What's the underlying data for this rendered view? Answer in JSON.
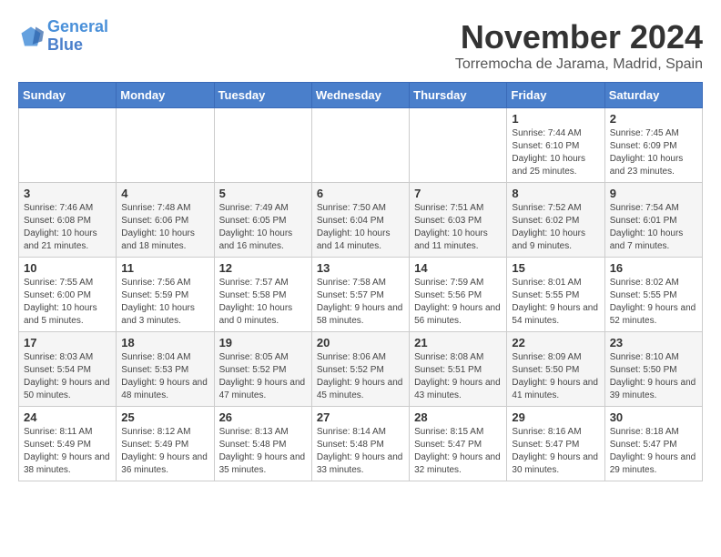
{
  "logo": {
    "line1": "General",
    "line2": "Blue"
  },
  "title": "November 2024",
  "subtitle": "Torremocha de Jarama, Madrid, Spain",
  "weekdays": [
    "Sunday",
    "Monday",
    "Tuesday",
    "Wednesday",
    "Thursday",
    "Friday",
    "Saturday"
  ],
  "weeks": [
    [
      {
        "day": "",
        "info": ""
      },
      {
        "day": "",
        "info": ""
      },
      {
        "day": "",
        "info": ""
      },
      {
        "day": "",
        "info": ""
      },
      {
        "day": "",
        "info": ""
      },
      {
        "day": "1",
        "info": "Sunrise: 7:44 AM\nSunset: 6:10 PM\nDaylight: 10 hours\nand 25 minutes."
      },
      {
        "day": "2",
        "info": "Sunrise: 7:45 AM\nSunset: 6:09 PM\nDaylight: 10 hours\nand 23 minutes."
      }
    ],
    [
      {
        "day": "3",
        "info": "Sunrise: 7:46 AM\nSunset: 6:08 PM\nDaylight: 10 hours\nand 21 minutes."
      },
      {
        "day": "4",
        "info": "Sunrise: 7:48 AM\nSunset: 6:06 PM\nDaylight: 10 hours\nand 18 minutes."
      },
      {
        "day": "5",
        "info": "Sunrise: 7:49 AM\nSunset: 6:05 PM\nDaylight: 10 hours\nand 16 minutes."
      },
      {
        "day": "6",
        "info": "Sunrise: 7:50 AM\nSunset: 6:04 PM\nDaylight: 10 hours\nand 14 minutes."
      },
      {
        "day": "7",
        "info": "Sunrise: 7:51 AM\nSunset: 6:03 PM\nDaylight: 10 hours\nand 11 minutes."
      },
      {
        "day": "8",
        "info": "Sunrise: 7:52 AM\nSunset: 6:02 PM\nDaylight: 10 hours\nand 9 minutes."
      },
      {
        "day": "9",
        "info": "Sunrise: 7:54 AM\nSunset: 6:01 PM\nDaylight: 10 hours\nand 7 minutes."
      }
    ],
    [
      {
        "day": "10",
        "info": "Sunrise: 7:55 AM\nSunset: 6:00 PM\nDaylight: 10 hours\nand 5 minutes."
      },
      {
        "day": "11",
        "info": "Sunrise: 7:56 AM\nSunset: 5:59 PM\nDaylight: 10 hours\nand 3 minutes."
      },
      {
        "day": "12",
        "info": "Sunrise: 7:57 AM\nSunset: 5:58 PM\nDaylight: 10 hours\nand 0 minutes."
      },
      {
        "day": "13",
        "info": "Sunrise: 7:58 AM\nSunset: 5:57 PM\nDaylight: 9 hours\nand 58 minutes."
      },
      {
        "day": "14",
        "info": "Sunrise: 7:59 AM\nSunset: 5:56 PM\nDaylight: 9 hours\nand 56 minutes."
      },
      {
        "day": "15",
        "info": "Sunrise: 8:01 AM\nSunset: 5:55 PM\nDaylight: 9 hours\nand 54 minutes."
      },
      {
        "day": "16",
        "info": "Sunrise: 8:02 AM\nSunset: 5:55 PM\nDaylight: 9 hours\nand 52 minutes."
      }
    ],
    [
      {
        "day": "17",
        "info": "Sunrise: 8:03 AM\nSunset: 5:54 PM\nDaylight: 9 hours\nand 50 minutes."
      },
      {
        "day": "18",
        "info": "Sunrise: 8:04 AM\nSunset: 5:53 PM\nDaylight: 9 hours\nand 48 minutes."
      },
      {
        "day": "19",
        "info": "Sunrise: 8:05 AM\nSunset: 5:52 PM\nDaylight: 9 hours\nand 47 minutes."
      },
      {
        "day": "20",
        "info": "Sunrise: 8:06 AM\nSunset: 5:52 PM\nDaylight: 9 hours\nand 45 minutes."
      },
      {
        "day": "21",
        "info": "Sunrise: 8:08 AM\nSunset: 5:51 PM\nDaylight: 9 hours\nand 43 minutes."
      },
      {
        "day": "22",
        "info": "Sunrise: 8:09 AM\nSunset: 5:50 PM\nDaylight: 9 hours\nand 41 minutes."
      },
      {
        "day": "23",
        "info": "Sunrise: 8:10 AM\nSunset: 5:50 PM\nDaylight: 9 hours\nand 39 minutes."
      }
    ],
    [
      {
        "day": "24",
        "info": "Sunrise: 8:11 AM\nSunset: 5:49 PM\nDaylight: 9 hours\nand 38 minutes."
      },
      {
        "day": "25",
        "info": "Sunrise: 8:12 AM\nSunset: 5:49 PM\nDaylight: 9 hours\nand 36 minutes."
      },
      {
        "day": "26",
        "info": "Sunrise: 8:13 AM\nSunset: 5:48 PM\nDaylight: 9 hours\nand 35 minutes."
      },
      {
        "day": "27",
        "info": "Sunrise: 8:14 AM\nSunset: 5:48 PM\nDaylight: 9 hours\nand 33 minutes."
      },
      {
        "day": "28",
        "info": "Sunrise: 8:15 AM\nSunset: 5:47 PM\nDaylight: 9 hours\nand 32 minutes."
      },
      {
        "day": "29",
        "info": "Sunrise: 8:16 AM\nSunset: 5:47 PM\nDaylight: 9 hours\nand 30 minutes."
      },
      {
        "day": "30",
        "info": "Sunrise: 8:18 AM\nSunset: 5:47 PM\nDaylight: 9 hours\nand 29 minutes."
      }
    ]
  ]
}
